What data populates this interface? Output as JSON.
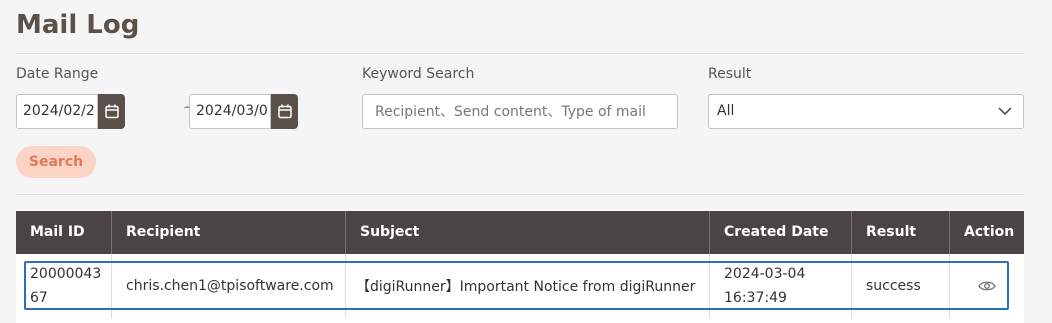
{
  "page": {
    "title": "Mail Log"
  },
  "filters": {
    "date_range_label": "Date Range",
    "start_date": "2024/02/2",
    "separator": "~",
    "end_date": "2024/03/0",
    "keyword_label": "Keyword Search",
    "keyword_placeholder": "Recipient、Send content、Type of mail",
    "keyword_value": "",
    "result_label": "Result",
    "result_selected": "All"
  },
  "actions": {
    "search_label": "Search"
  },
  "table": {
    "columns": [
      "Mail ID",
      "Recipient",
      "Subject",
      "Created Date",
      "Result",
      "Action"
    ],
    "rows": [
      {
        "mail_id_line1": "20000043",
        "mail_id_line2": "67",
        "recipient": "chris.chen1@tpisoftware.com",
        "subject": "【digiRunner】Important Notice from digiRunner",
        "created_date_line1": "2024-03-04",
        "created_date_line2": "16:37:49",
        "result": "success",
        "action_icon": "eye-icon"
      }
    ]
  },
  "colors": {
    "header_bg": "#4a4542",
    "calendar_btn": "#5b514a",
    "search_btn_bg": "#fbd4c6",
    "search_btn_text": "#e27a55",
    "row_highlight": "#2f6fb8"
  }
}
